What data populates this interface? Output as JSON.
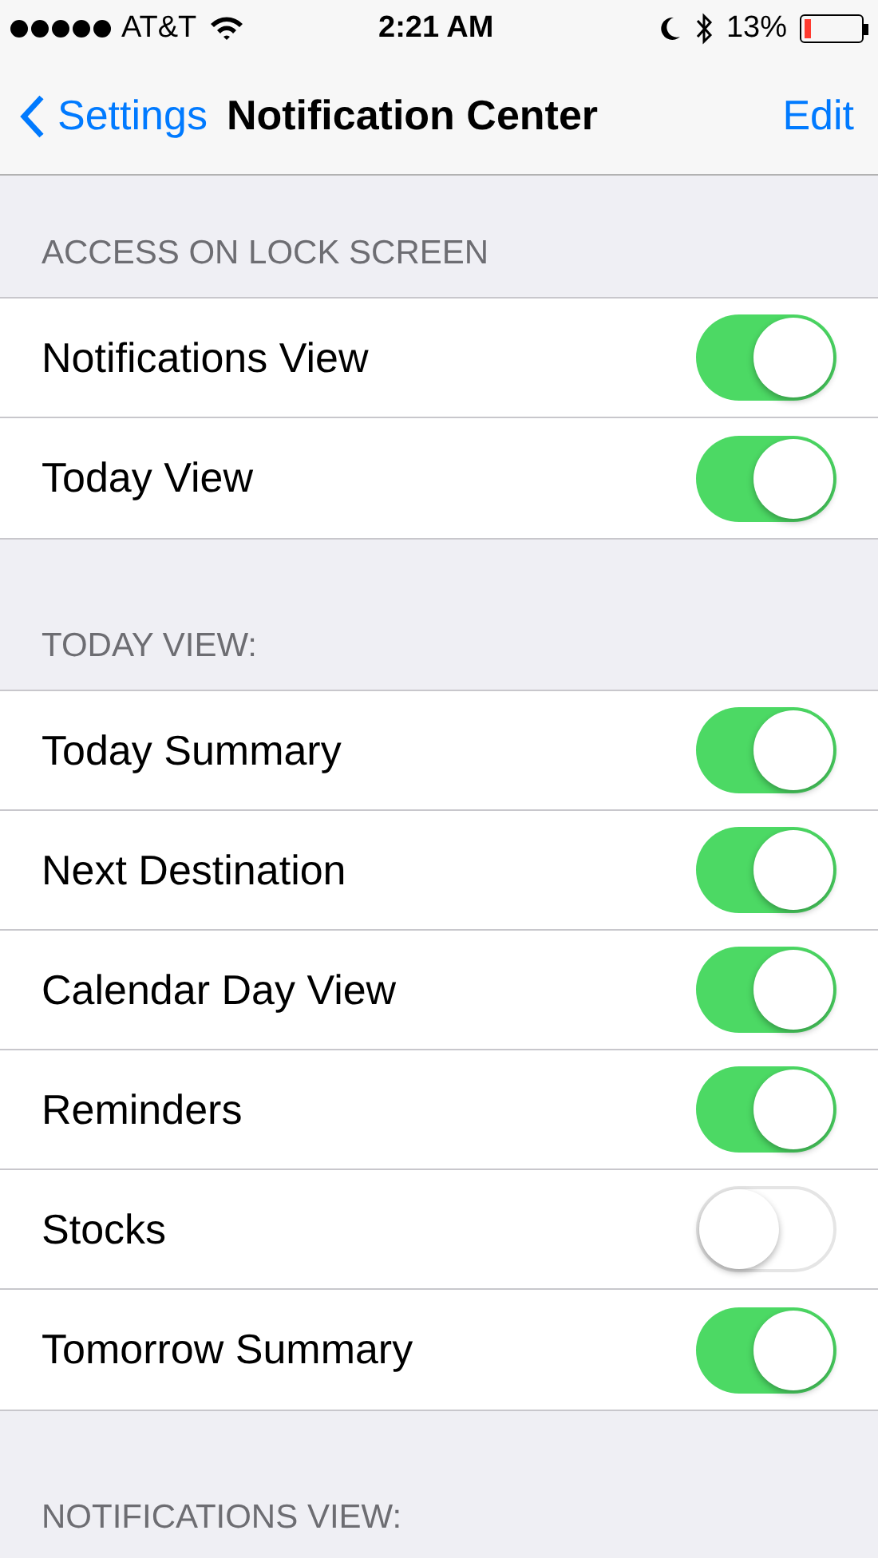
{
  "status_bar": {
    "carrier": "AT&T",
    "time": "2:21 AM",
    "battery_percent": "13%"
  },
  "nav_bar": {
    "back": "Settings",
    "title": "Notification Center",
    "action": "Edit"
  },
  "sections": [
    {
      "header": "ACCESS ON LOCK SCREEN",
      "rows": [
        {
          "label": "Notifications View",
          "on": true
        },
        {
          "label": "Today View",
          "on": true
        }
      ]
    },
    {
      "header": "TODAY VIEW:",
      "rows": [
        {
          "label": "Today Summary",
          "on": true
        },
        {
          "label": "Next Destination",
          "on": true
        },
        {
          "label": "Calendar Day View",
          "on": true
        },
        {
          "label": "Reminders",
          "on": true
        },
        {
          "label": "Stocks",
          "on": false
        },
        {
          "label": "Tomorrow Summary",
          "on": true
        }
      ]
    },
    {
      "header": "NOTIFICATIONS VIEW:"
    }
  ]
}
